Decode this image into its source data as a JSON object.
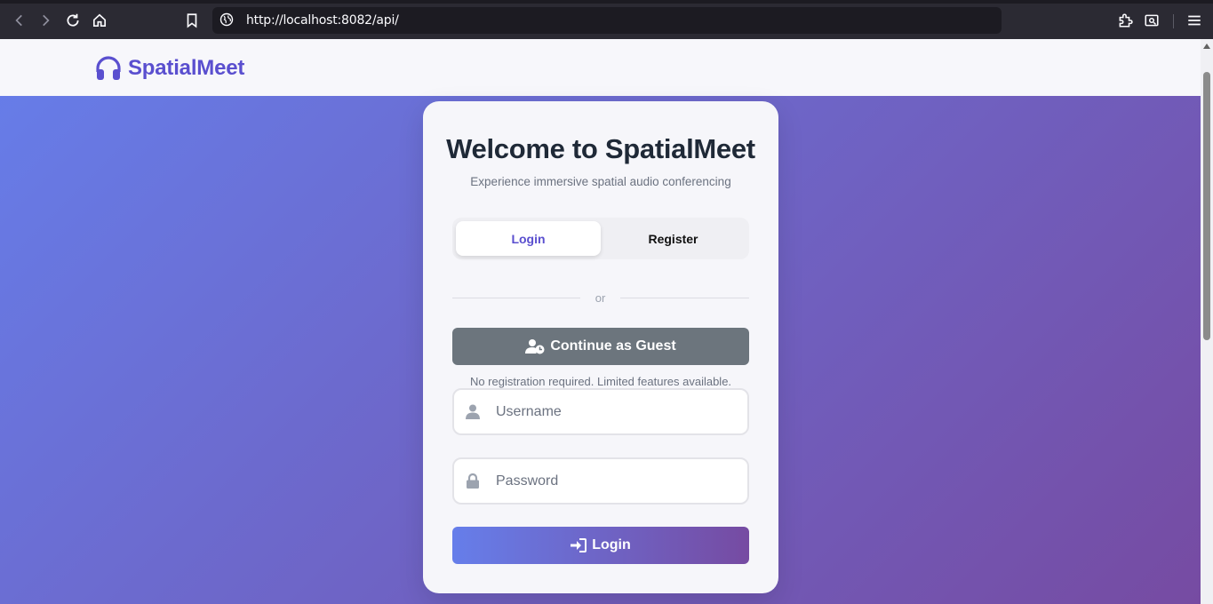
{
  "browser": {
    "url": "http://localhost:8082/api/",
    "icons": [
      "back-icon",
      "forward-icon",
      "reload-icon",
      "home-icon",
      "bookmark-icon",
      "globe-icon",
      "extensions-icon",
      "screenshot-icon",
      "menu-icon"
    ]
  },
  "navbar": {
    "brand_name": "SpatialMeet",
    "logo_icon": "headphones-icon",
    "brand_color": "#5a4fcf"
  },
  "auth": {
    "title": "Welcome to SpatialMeet",
    "subtitle": "Experience immersive spatial audio conferencing",
    "tabs": [
      {
        "label": "Login",
        "active": true
      },
      {
        "label": "Register",
        "active": false
      }
    ],
    "divider_text": "or",
    "guest_button": "Continue as Guest",
    "guest_note": "No registration required. Limited features available.",
    "username_placeholder": "Username",
    "password_placeholder": "Password",
    "login_button": "Login"
  },
  "colors": {
    "gradient_start": "#667eea",
    "gradient_end": "#764ba2",
    "guest_button_bg": "#6c757d"
  }
}
